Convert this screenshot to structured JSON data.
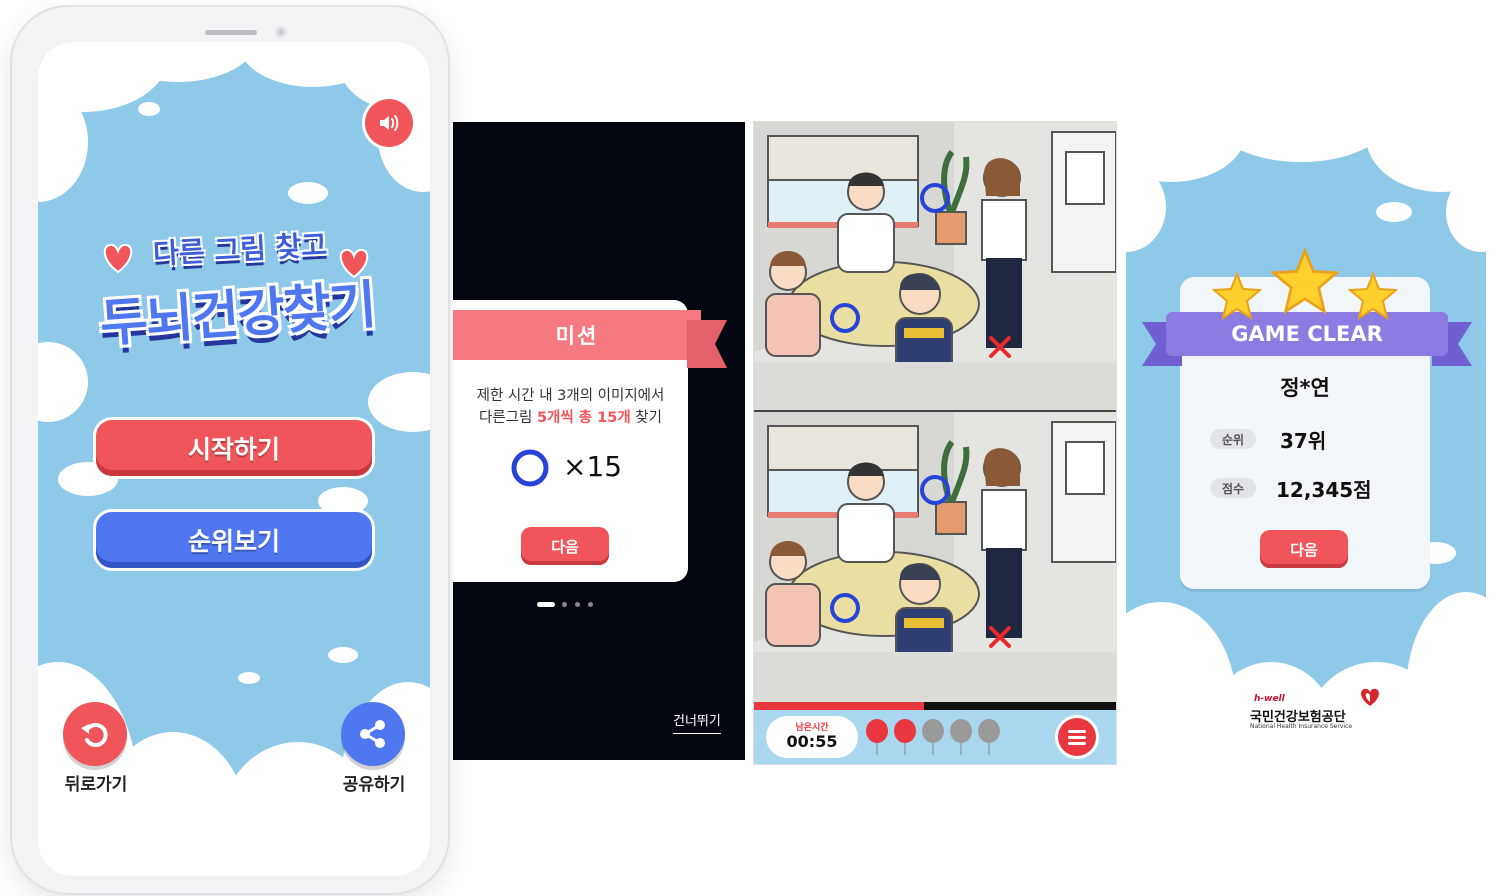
{
  "phone": {
    "title_top": "다른 그림 찾고",
    "title_main": "두뇌건강찾기",
    "start_button": "시작하기",
    "rank_button": "순위보기",
    "back_label": "뒤로가기",
    "share_label": "공유하기",
    "icons": [
      "sound-icon",
      "back-arrow-icon",
      "share-icon"
    ]
  },
  "mission": {
    "ribbon_title": "미션",
    "line1": "제한 시간 내 3개의 이미지에서",
    "line2_prefix": "다른그림 ",
    "line2_highlight": "5개씩 총 15개",
    "line2_suffix": " 찾기",
    "count": "×15",
    "next_button": "다음",
    "skip_link": "건너뛰기",
    "page_indicator": {
      "pages": 4,
      "active": 1
    },
    "colors": {
      "highlight": "#f05559",
      "ribbon": "#f6797f"
    }
  },
  "puzzle": {
    "time_label": "남은시간",
    "time_value": "00:55",
    "balloons": [
      "red",
      "red",
      "gray",
      "gray",
      "gray"
    ],
    "menu_icon": "menu-icon",
    "progress": 0.47
  },
  "clear": {
    "title": "GAME CLEAR",
    "name": "정*연",
    "rank_label": "순위",
    "rank_value": "37위",
    "score_label": "점수",
    "score_value": "12,345점",
    "next_button": "다음",
    "logo_small": "h-well",
    "logo_org": "국민건강보험공단",
    "logo_english": "National Health Insurance Service",
    "stars": 3
  }
}
